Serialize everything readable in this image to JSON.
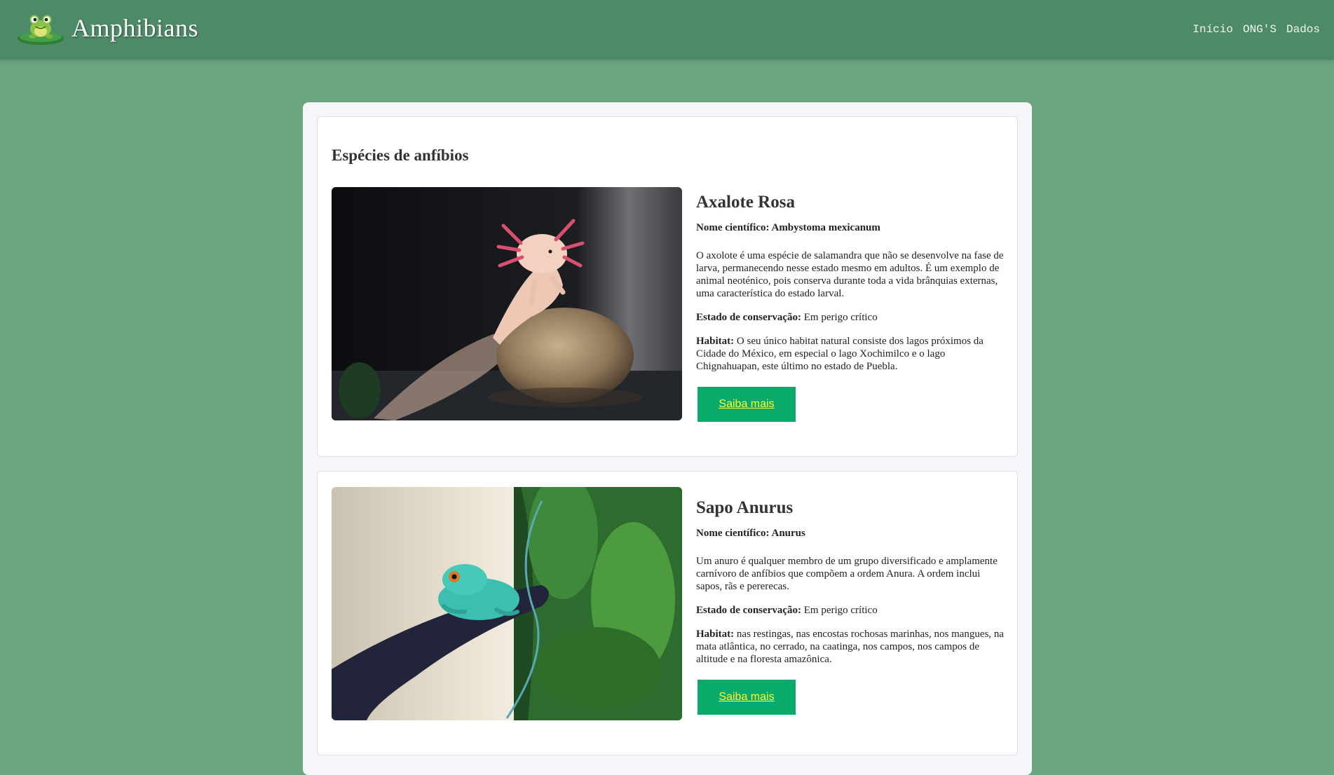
{
  "header": {
    "brand": "Amphibians",
    "nav": [
      "Início",
      "ONG'S",
      "Dados"
    ]
  },
  "main": {
    "section_title": "Espécies de anfíbios",
    "species": [
      {
        "name": "Axalote Rosa",
        "scientific_label": "Nome científico:",
        "scientific_value": "Ambystoma mexicanum",
        "description": "O axolote é uma espécie de salamandra que não se desenvolve na fase de larva, permanecendo nesse estado mesmo em adultos. É um exemplo de animal neoténico, pois conserva durante toda a vida brânquias externas, uma característica do estado larval.",
        "status_label": "Estado de conservação:",
        "status_value": "Em perigo crítico",
        "habitat_label": "Habitat:",
        "habitat_value": "O seu único habitat natural consiste dos lagos próximos da Cidade do México, em especial o lago Xochimilco e o lago Chignahuapan, este último no estado de Puebla.",
        "button": "Saiba mais"
      },
      {
        "name": "Sapo Anurus",
        "scientific_label": "Nome científico:",
        "scientific_value": "Anurus",
        "description": "Um anuro é qualquer membro de um grupo diversificado e amplamente carnívoro de anfíbios que compõem a ordem Anura. A ordem inclui sapos, rãs e pererecas.",
        "status_label": "Estado de conservação:",
        "status_value": "Em perigo crítico",
        "habitat_label": "Habitat:",
        "habitat_value": "nas restingas, nas encostas rochosas marinhas, nos mangues, na mata atlântica, no cerrado, na caatinga, nos campos, nos campos de altitude e na floresta amazônica.",
        "button": "Saiba mais"
      }
    ]
  },
  "colors": {
    "background": "#6ba57f",
    "header": "#4d8a67",
    "button": "#0aab6a",
    "button_text": "#ffff33"
  }
}
